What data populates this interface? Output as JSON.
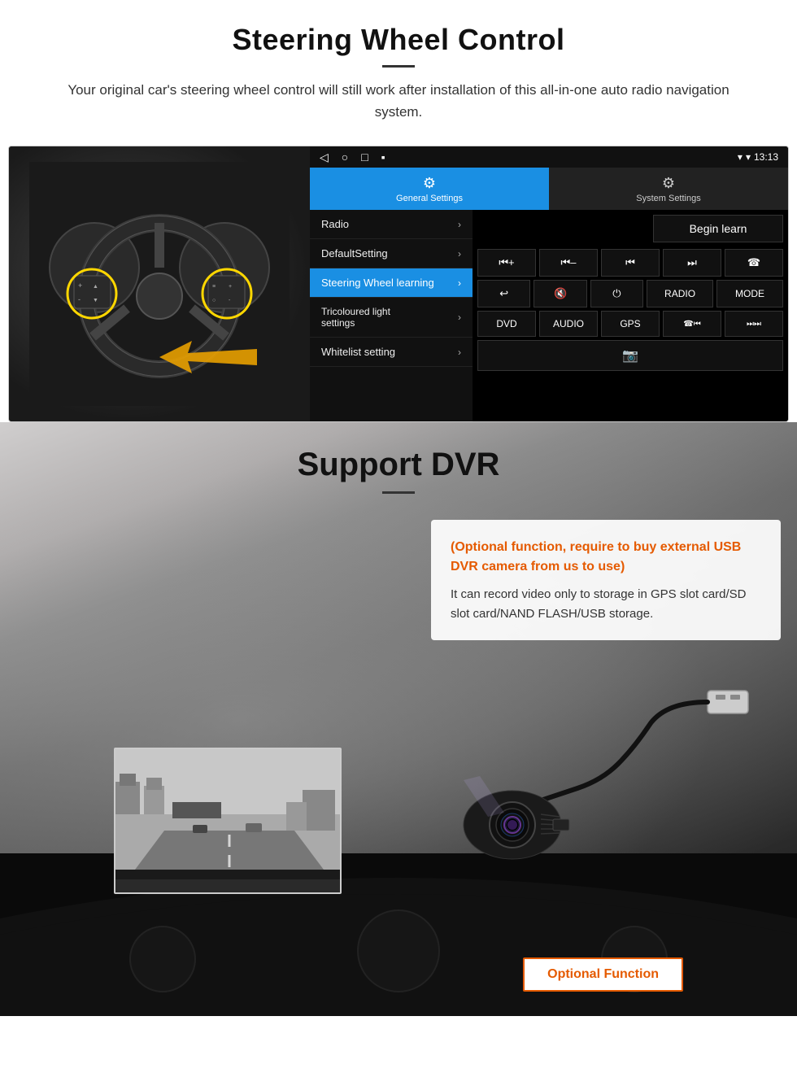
{
  "section1": {
    "title": "Steering Wheel Control",
    "subtitle": "Your original car's steering wheel control will still work after installation of this all-in-one auto radio navigation system.",
    "statusBar": {
      "time": "13:13",
      "navBack": "◁",
      "navHome": "○",
      "navRecent": "□",
      "navMenu": "▪"
    },
    "tabs": [
      {
        "label": "General Settings",
        "icon": "⚙",
        "active": true
      },
      {
        "label": "System Settings",
        "icon": "⚙",
        "active": false
      }
    ],
    "menuItems": [
      {
        "label": "Radio",
        "active": false
      },
      {
        "label": "DefaultSetting",
        "active": false
      },
      {
        "label": "Steering Wheel learning",
        "active": true
      },
      {
        "label": "Tricoloured light settings",
        "active": false
      },
      {
        "label": "Whitelist setting",
        "active": false
      }
    ],
    "beginLearnBtn": "Begin learn",
    "controlButtons": [
      [
        "⏮+",
        "⏮-",
        "⏮⏮",
        "⏭⏭",
        "☎"
      ],
      [
        "↩",
        "🔇",
        "⏻",
        "RADIO",
        "MODE"
      ],
      [
        "DVD",
        "AUDIO",
        "GPS",
        "☎⏮",
        "⏭⏭"
      ]
    ]
  },
  "section2": {
    "title": "Support DVR",
    "optionalText": "(Optional function, require to buy external USB DVR camera from us to use)",
    "descText": "It can record video only to storage in GPS slot card/SD slot card/NAND FLASH/USB storage.",
    "optionalFnBtn": "Optional Function"
  }
}
